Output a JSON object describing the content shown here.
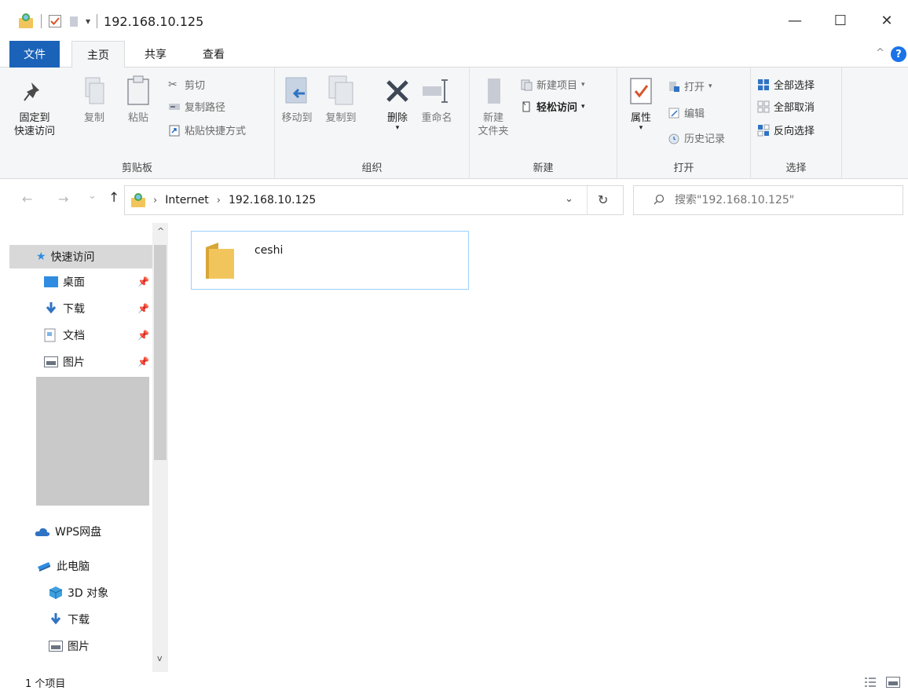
{
  "title_bar": {
    "title": "192.168.10.125",
    "icons": [
      "network-folder-icon",
      "properties-check-icon",
      "new-folder-icon",
      "customize-dropdown-icon"
    ],
    "controls": {
      "minimize": "—",
      "maximize": "☐",
      "close": "✕"
    }
  },
  "tabs": {
    "file": "文件",
    "home": "主页",
    "share": "共享",
    "view": "查看",
    "collapse_glyph": "^",
    "help_glyph": "?"
  },
  "ribbon": {
    "clipboard": {
      "label": "剪贴板",
      "pin_line1": "固定到",
      "pin_line2": "快速访问",
      "copy": "复制",
      "paste": "粘贴",
      "cut": "剪切",
      "copy_path": "复制路径",
      "paste_shortcut": "粘贴快捷方式"
    },
    "organize": {
      "label": "组织",
      "move_to": "移动到",
      "copy_to": "复制到",
      "delete": "删除",
      "rename": "重命名"
    },
    "new": {
      "label": "新建",
      "new_folder_line1": "新建",
      "new_folder_line2": "文件夹",
      "new_item": "新建项目",
      "easy_access": "轻松访问"
    },
    "open": {
      "label": "打开",
      "properties": "属性",
      "open": "打开",
      "edit": "编辑",
      "history": "历史记录"
    },
    "select": {
      "label": "选择",
      "select_all": "全部选择",
      "select_none": "全部取消",
      "invert": "反向选择"
    }
  },
  "navigation": {
    "back": "←",
    "forward": "→",
    "recent": "⌄",
    "up": "↑",
    "breadcrumb": [
      "Internet",
      "192.168.10.125"
    ],
    "separator": "›",
    "dropdown": "⌄",
    "refresh": "↻",
    "search_placeholder": "搜索\"192.168.10.125\""
  },
  "sidebar": {
    "quick_access": "快速访问",
    "quick_items": [
      {
        "label": "桌面",
        "icon": "desktop-icon"
      },
      {
        "label": "下载",
        "icon": "download-icon"
      },
      {
        "label": "文档",
        "icon": "documents-icon"
      },
      {
        "label": "图片",
        "icon": "pictures-icon"
      }
    ],
    "wps": "WPS网盘",
    "this_pc": "此电脑",
    "pc_items": [
      {
        "label": "3D 对象",
        "icon": "3d-objects-icon"
      },
      {
        "label": "下载",
        "icon": "download-icon"
      },
      {
        "label": "图片",
        "icon": "pictures-icon"
      }
    ],
    "scroll_up": "^",
    "scroll_down": "v"
  },
  "content": {
    "items": [
      {
        "name": "ceshi",
        "icon": "folder-icon"
      }
    ]
  },
  "status_bar": {
    "item_count": "1 个项目"
  },
  "colors": {
    "accent": "#1a63b9",
    "ribbon_bg": "#f5f6f7",
    "folder": "#f2c55c",
    "selection_border": "#99d1ff"
  }
}
